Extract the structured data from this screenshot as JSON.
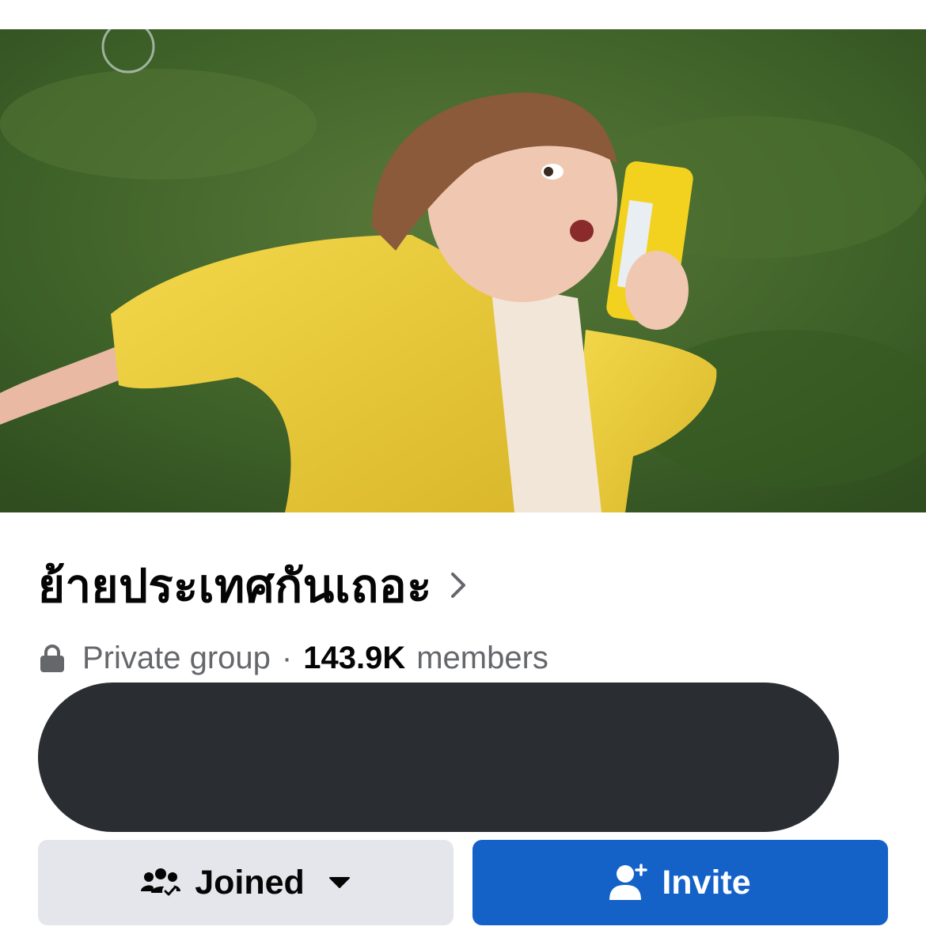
{
  "cover": {
    "alt": "Group cover photo"
  },
  "group": {
    "name": "ย้ายประเทศกันเถอะ",
    "privacy": "Private group",
    "separator": "·",
    "member_count": "143.9K",
    "member_label": "members"
  },
  "actions": {
    "joined_label": "Joined",
    "invite_label": "Invite"
  },
  "icons": {
    "title_chevron": "chevron-right-icon",
    "privacy": "lock-icon",
    "joined": "group-joined-icon",
    "joined_menu": "caret-down-icon",
    "invite": "add-person-icon"
  },
  "colors": {
    "invite_button": "#1461c8",
    "joined_button": "#e4e6eb",
    "redacted_bar": "#2a2e33",
    "meta_text": "#65676b"
  }
}
